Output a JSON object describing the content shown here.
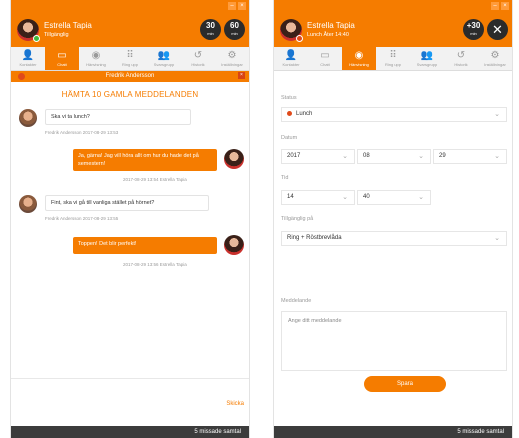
{
  "left": {
    "titlebar": "",
    "profile": {
      "name": "Estrella Tapia",
      "status": "Tillgänglig",
      "status_color": "#3dbb3d"
    },
    "badges": [
      {
        "num": "30",
        "unit": "min"
      },
      {
        "num": "60",
        "unit": "min"
      }
    ],
    "tabs": [
      {
        "label": "Kontakter",
        "icon": "person-icon",
        "glyph": "👤"
      },
      {
        "label": "Chatt",
        "icon": "chat-icon",
        "glyph": "▭"
      },
      {
        "label": "Hänvisning",
        "icon": "eye-icon",
        "glyph": "◉"
      },
      {
        "label": "Ring upp",
        "icon": "dialpad-icon",
        "glyph": "⠿"
      },
      {
        "label": "Svarsgrupp",
        "icon": "group-icon",
        "glyph": "👥"
      },
      {
        "label": "Historik",
        "icon": "history-icon",
        "glyph": "↺"
      },
      {
        "label": "Inställningar",
        "icon": "gear-icon",
        "glyph": "⚙"
      }
    ],
    "chat_header": "Fredrik Andersson",
    "load_older": "HÄMTA 10 GAMLA MEDDELANDEN",
    "messages": [
      {
        "text": "Ska vi ta lunch?",
        "meta": "Fredrik Andersson   2017-08-29 13:53"
      },
      {
        "text": "Ja, gärna! Jag vill höra allt om hur du hade det på semestern!",
        "meta": "2017-08-29 13:54   Estrella Tapia"
      },
      {
        "text": "Fint, ska vi gå till vanliga stället på hörnet?",
        "meta": "Fredrik Andersson   2017-08-29 13:55"
      },
      {
        "text": "Toppen! Det blir perfekt!",
        "meta": "2017-08-29 13:56   Estrella Tapia"
      }
    ],
    "send_label": "Skicka",
    "bottom": "5 missade samtal"
  },
  "right": {
    "titlebar": "",
    "profile": {
      "name": "Estrella Tapia",
      "status": "Lunch Åter 14:40",
      "status_color": "#e04a1a"
    },
    "badges": [
      {
        "num": "+30",
        "unit": "min"
      },
      {
        "num": "✕",
        "unit": ""
      }
    ],
    "form": {
      "status_label": "Status",
      "status_value": "Lunch",
      "status_color": "#e04a1a",
      "date_label": "Datum",
      "year": "2017",
      "month": "08",
      "day": "29",
      "time_label": "Tid",
      "hour": "14",
      "minute": "40",
      "reachable_label": "Tillgänglig på",
      "reachable_value": "Ring + Röstbrevlåda",
      "message_label": "Meddelande",
      "message_placeholder": "Ange ditt meddelande",
      "save_label": "Spara"
    },
    "bottom": "5 missade samtal"
  },
  "colors": {
    "accent": "#f57c00",
    "dark": "#2b2b2b"
  }
}
